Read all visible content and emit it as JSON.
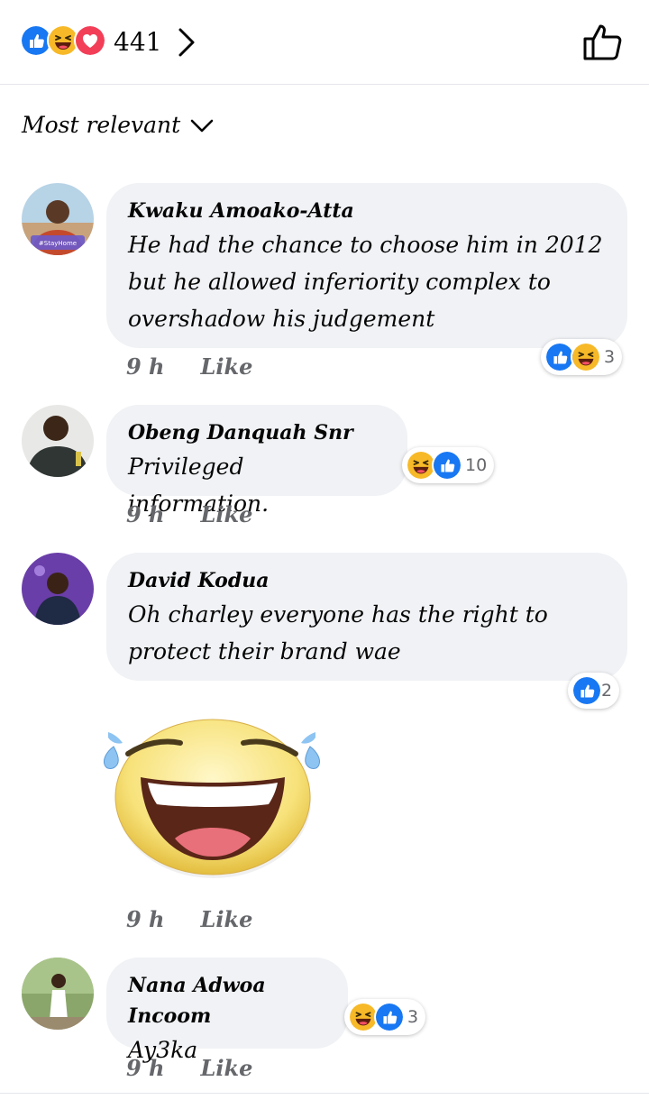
{
  "header": {
    "reaction_icons": [
      "like-icon",
      "haha-icon",
      "love-icon"
    ],
    "total_reactions": "441"
  },
  "sort": {
    "label": "Most relevant"
  },
  "comments": [
    {
      "author": "Kwaku Amoako-Atta",
      "lines": [
        "He had the chance to choose him in 2012",
        "but he allowed inferiority complex to",
        "overshadow his judgement"
      ],
      "time": "9 h",
      "like_label": "Like",
      "reactions": [
        "like-icon",
        "haha-icon"
      ],
      "reaction_count": "3",
      "avatar_text": "#StayHome"
    },
    {
      "author": "Obeng Danquah Snr",
      "lines": [
        "Privileged information."
      ],
      "time": "9 h",
      "like_label": "Like",
      "reactions": [
        "haha-icon",
        "like-icon"
      ],
      "reaction_count": "10"
    },
    {
      "author": "David Kodua",
      "lines": [
        "Oh charley everyone has the right to",
        "protect their brand wae"
      ],
      "time": "9 h",
      "like_label": "Like",
      "reactions": [
        "like-icon"
      ],
      "reaction_count": "2",
      "sticker": "laughing-sticker"
    },
    {
      "author": "Nana Adwoa Incoom",
      "lines": [
        "Ay3ka"
      ],
      "time": "9 h",
      "like_label": "Like",
      "reactions": [
        "haha-icon",
        "like-icon"
      ],
      "reaction_count": "3"
    }
  ],
  "colors": {
    "like": "#1877f2",
    "haha": "#f7b928",
    "love": "#f33e58",
    "bubble": "#f0f2f5",
    "meta": "#65676b"
  }
}
